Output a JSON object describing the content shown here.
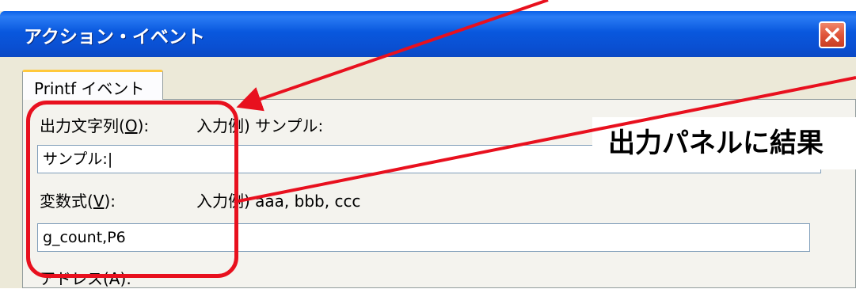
{
  "window": {
    "title": "アクション・イベント"
  },
  "tab": {
    "label": "Printf イベント"
  },
  "form": {
    "output_label": "出力文字列",
    "output_accel": "O",
    "output_example": "入力例) サンプル:",
    "output_value": "サンプル:|",
    "var_label": "変数式",
    "var_accel": "V",
    "var_example": "入力例) aaa, bbb, ccc",
    "var_value": "g_count,P6",
    "addr_label": "アドレス(A):"
  },
  "annotation": {
    "text": "出力パネルに結果",
    "color": "#e8101e"
  }
}
